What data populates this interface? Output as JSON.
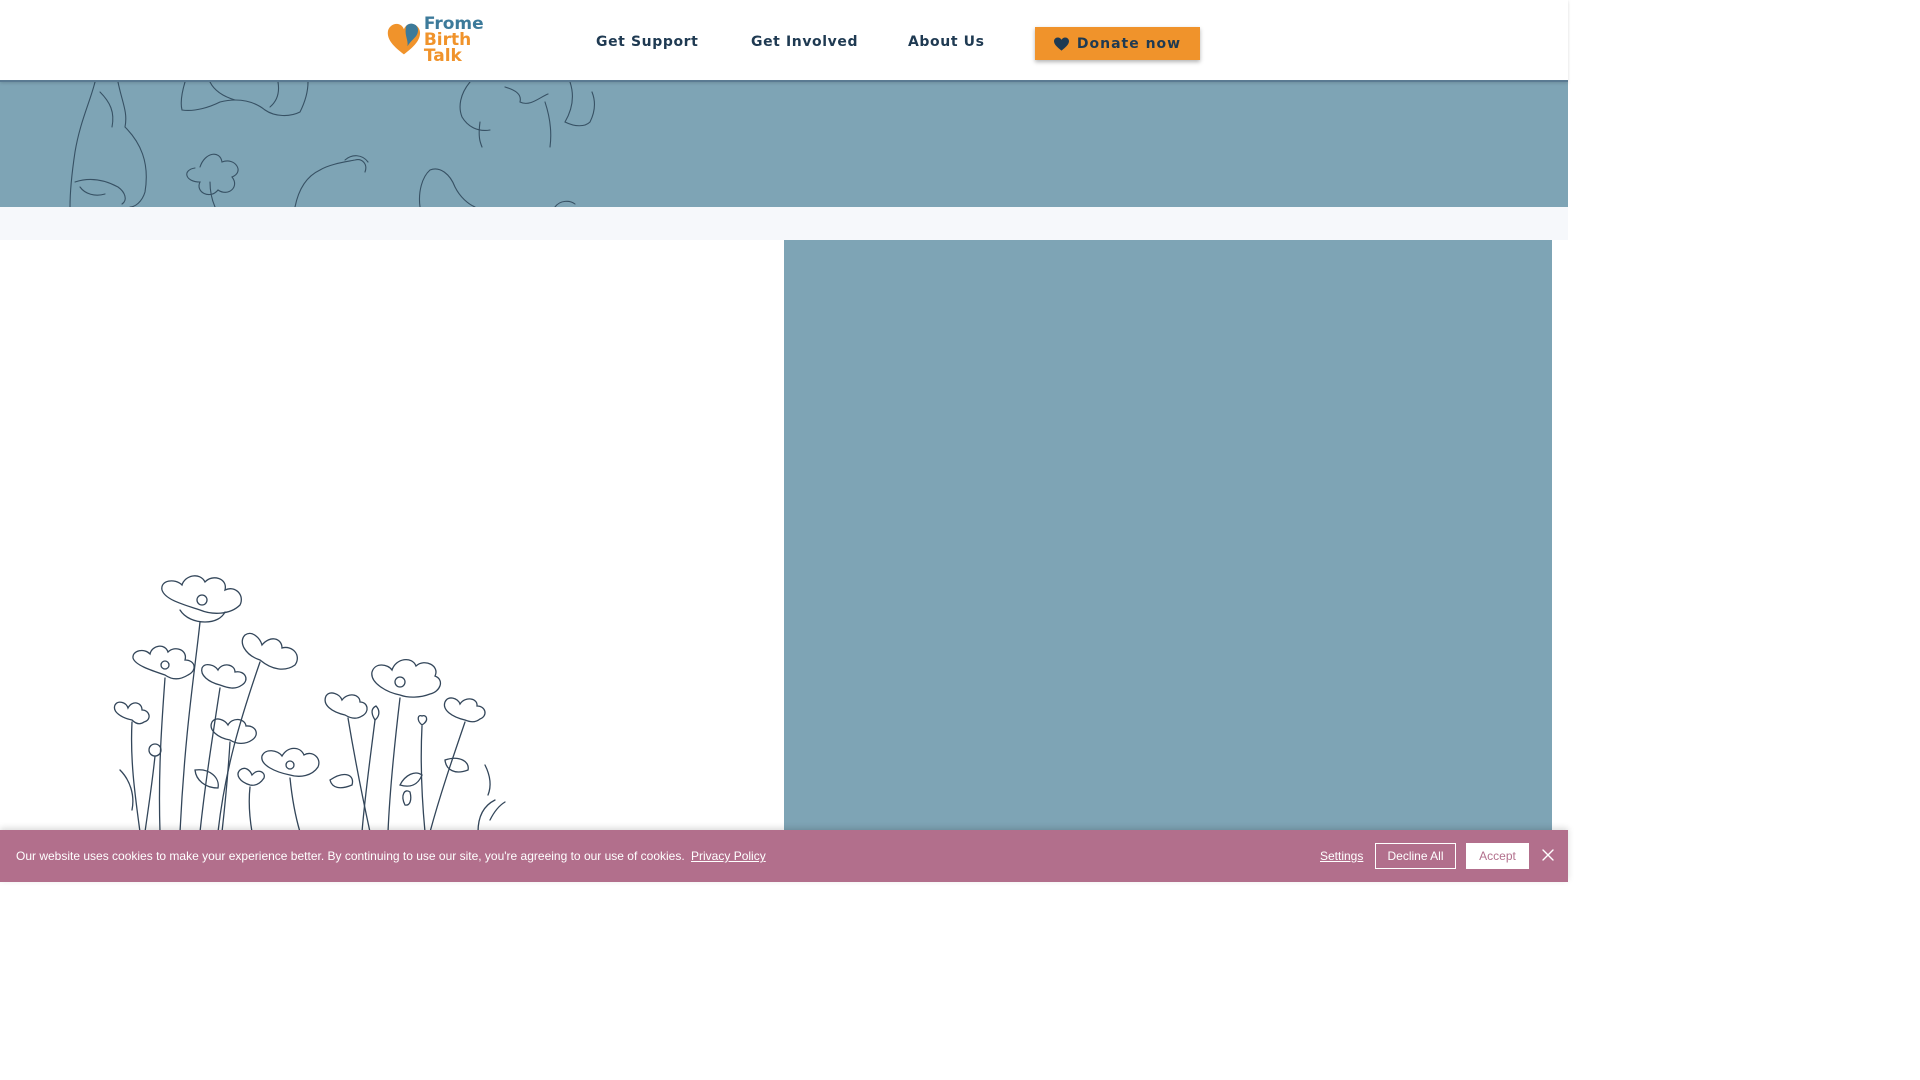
{
  "header": {
    "logo": {
      "line1": "Frome",
      "line2": "Birth Talk",
      "icon": "speech-heart-logo"
    },
    "nav": [
      {
        "label": "Get Support"
      },
      {
        "label": "Get Involved"
      },
      {
        "label": "About Us"
      }
    ],
    "donate": {
      "label": "Donate now",
      "icon": "heart-icon"
    }
  },
  "colors": {
    "accent_orange": "#f0932b",
    "logo_blue": "#3c7a9a",
    "hero_blue": "#7ea4b5",
    "text_navy": "#1f3a52",
    "cookie_pink": "#b26f8c"
  },
  "cookie_banner": {
    "message": "Our website uses cookies to make your experience better. By continuing to use our site, you're agreeing to our use of cookies.",
    "privacy_link": "Privacy Policy",
    "settings": "Settings",
    "decline": "Decline All",
    "accept": "Accept",
    "close_icon": "close-icon"
  }
}
